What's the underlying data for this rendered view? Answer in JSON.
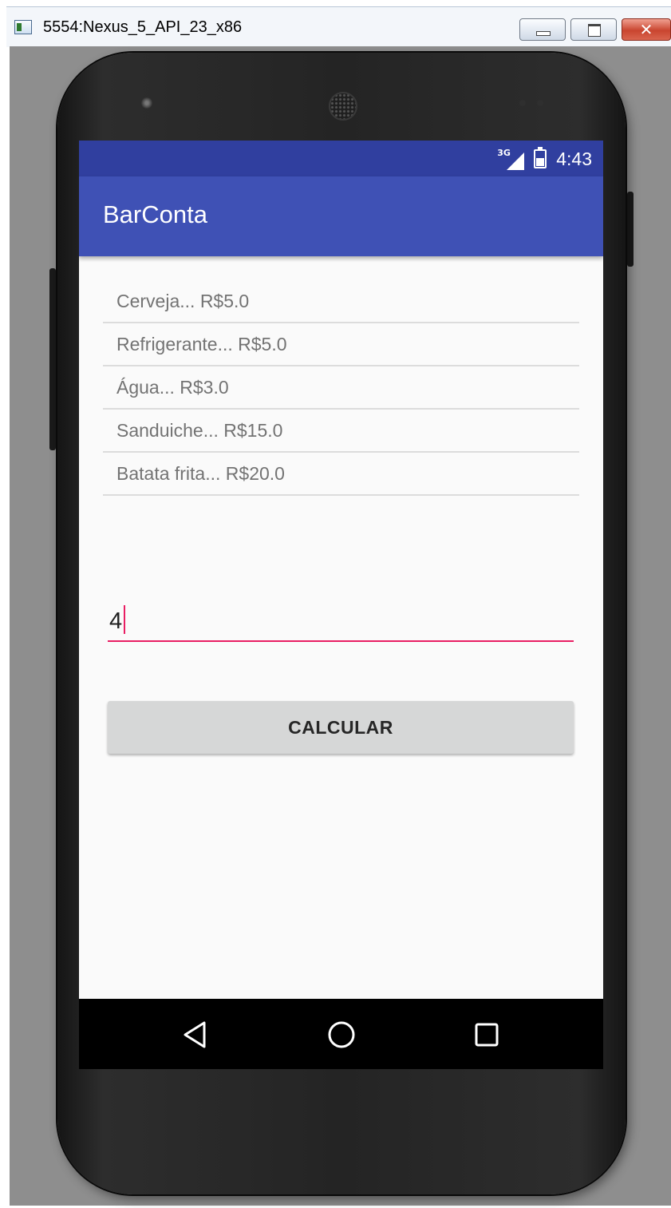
{
  "window": {
    "title": "5554:Nexus_5_API_23_x86",
    "controls": [
      "minimize",
      "maximize",
      "close"
    ],
    "close_glyph": "✕"
  },
  "status_bar": {
    "network_label": "3G",
    "time": "4:43",
    "icons": [
      "signal-icon",
      "battery-icon"
    ]
  },
  "app_bar": {
    "title": "BarConta"
  },
  "menu": {
    "items": [
      {
        "label": "Cerveja... R$5.0"
      },
      {
        "label": "Refrigerante... R$5.0"
      },
      {
        "label": "Água... R$3.0"
      },
      {
        "label": "Sanduiche... R$15.0"
      },
      {
        "label": "Batata frita... R$20.0"
      }
    ]
  },
  "input": {
    "value": "4"
  },
  "calc_button": {
    "label": "CALCULAR"
  },
  "nav_bar": {
    "icons": [
      "back-icon",
      "home-icon",
      "recents-icon"
    ]
  },
  "colors": {
    "status_bar": "#303f9f",
    "app_bar": "#3f51b5",
    "accent": "#e91e63",
    "button": "#d6d7d7",
    "list_text": "#737373"
  }
}
